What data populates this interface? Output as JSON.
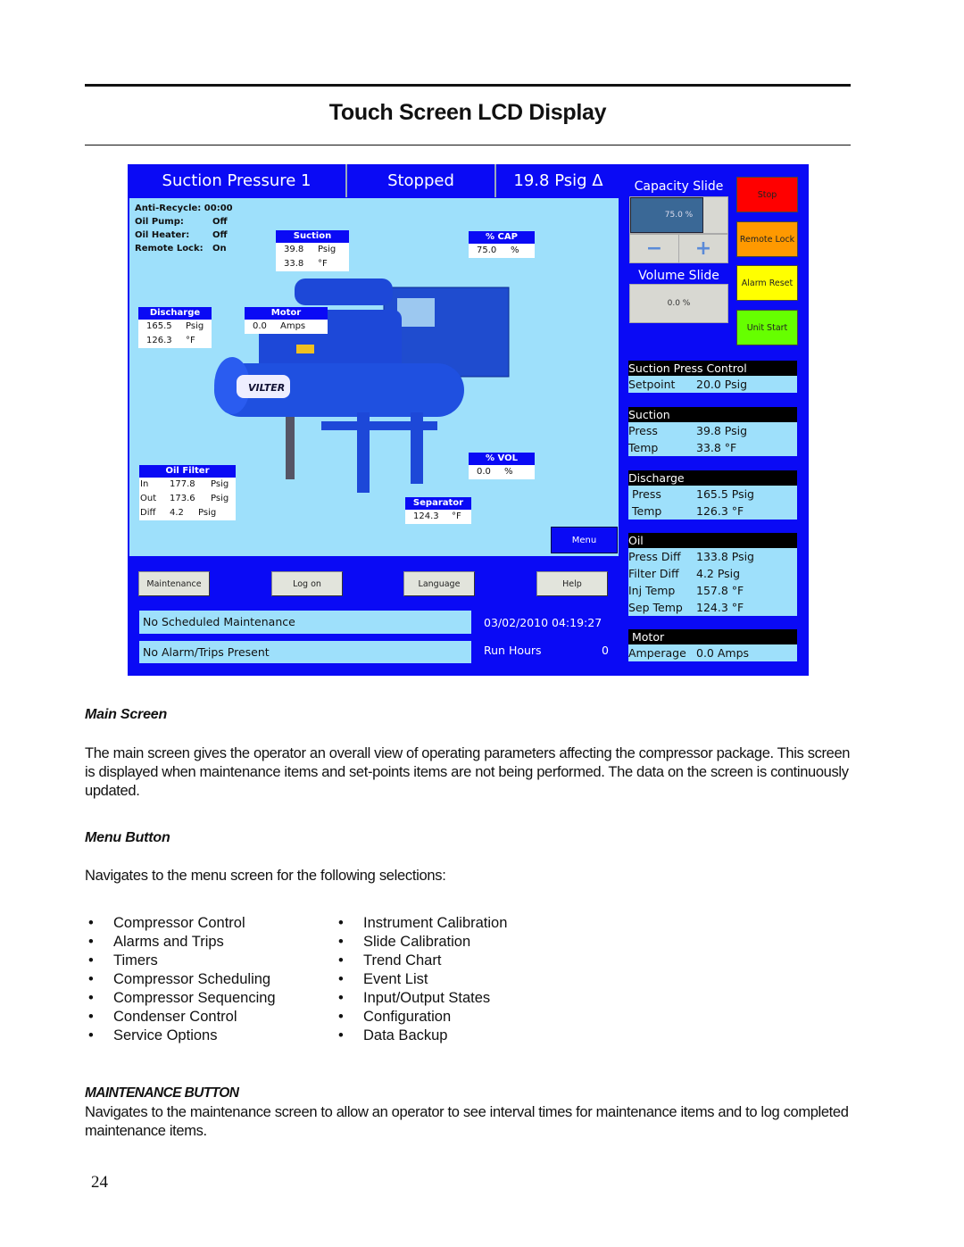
{
  "page": {
    "title": "Touch Screen LCD Display",
    "page_number": "24"
  },
  "screen": {
    "header": {
      "name": "Suction Pressure 1",
      "state": "Stopped",
      "pressure": "19.8 Psig Δ"
    },
    "status": [
      {
        "label": "Anti-Recycle:",
        "value": "00:00"
      },
      {
        "label": "Oil Pump:",
        "value": "Off"
      },
      {
        "label": "Oil Heater:",
        "value": "Off"
      },
      {
        "label": "Remote Lock:",
        "value": "On"
      }
    ],
    "suction": {
      "title": "Suction",
      "press": "39.8",
      "press_unit": "Psig",
      "temp": "33.8",
      "temp_unit": "°F"
    },
    "cap": {
      "title": "% CAP",
      "value": "75.0",
      "unit": "%"
    },
    "discharge": {
      "title": "Discharge",
      "press": "165.5",
      "press_unit": "Psig",
      "temp": "126.3",
      "temp_unit": "°F"
    },
    "motor": {
      "title": "Motor",
      "value": "0.0",
      "unit": "Amps"
    },
    "oil_filter": {
      "title": "Oil Filter",
      "rows": [
        {
          "label": "In",
          "value": "177.8",
          "unit": "Psig"
        },
        {
          "label": "Out",
          "value": "173.6",
          "unit": "Psig"
        },
        {
          "label": "Diff",
          "value": "4.2",
          "unit": "Psig"
        }
      ]
    },
    "vol": {
      "title": "% VOL",
      "value": "0.0",
      "unit": "%"
    },
    "separator": {
      "title": "Separator",
      "value": "124.3",
      "unit": "°F"
    },
    "logo": "VILTER",
    "menu_label": "Menu",
    "buttons": {
      "maintenance": "Maintenance",
      "logon": "Log on",
      "language": "Language",
      "help": "Help"
    },
    "maintenance_status": "No Scheduled Maintenance",
    "alarm_status": "No Alarm/Trips Present",
    "datetime": "03/02/2010  04:19:27",
    "run_hours_label": "Run Hours",
    "run_hours": "0",
    "capacity_slide": {
      "label": "Capacity Slide",
      "value_text": "75.0 %",
      "percent": 75,
      "minus": "minus-icon",
      "plus": "plus-icon"
    },
    "volume_slide": {
      "label": "Volume Slide",
      "value_text": "0.0 %",
      "percent": 0
    },
    "control_buttons": [
      {
        "label": "Stop",
        "color": "#ff0000"
      },
      {
        "label": "Remote Lock",
        "color": "#ff9900"
      },
      {
        "label": "Alarm Reset",
        "color": "#ffff00"
      },
      {
        "label": "Unit Start",
        "color": "#66ff00"
      }
    ],
    "panels": {
      "spc": {
        "title": "Suction Press Control",
        "rows": [
          {
            "label": "Setpoint",
            "value": "20.0 Psig"
          }
        ]
      },
      "suction": {
        "title": "Suction",
        "rows": [
          {
            "label": "Press",
            "value": "39.8 Psig"
          },
          {
            "label": "Temp",
            "value": "33.8 °F"
          }
        ]
      },
      "discharge": {
        "title": "Discharge",
        "rows": [
          {
            "label": "Press",
            "value": "165.5 Psig"
          },
          {
            "label": "Temp",
            "value": "126.3 °F"
          }
        ]
      },
      "oil": {
        "title": "Oil",
        "rows": [
          {
            "label": "Press Diff",
            "value": "133.8 Psig"
          },
          {
            "label": "Filter Diff",
            "value": "4.2 Psig"
          },
          {
            "label": "Inj Temp",
            "value": "157.8 °F"
          },
          {
            "label": "Sep Temp",
            "value": "124.3 °F"
          }
        ]
      },
      "motor": {
        "title": "Motor",
        "rows": [
          {
            "label": "Amperage",
            "value": "0.0 Amps"
          }
        ]
      }
    }
  },
  "sections": {
    "main_heading": "Main Screen",
    "main_text": "The main screen gives the operator an overall view of operating parameters affecting the compressor package. This screen is displayed when maintenance items and set-points items are not being performed.  The data on the screen is continuously updated.",
    "menu_heading": "Menu Button",
    "menu_text": "Navigates to the menu screen for the following selections:",
    "menu_col1": [
      "Compressor Control",
      "Alarms and Trips",
      "Timers",
      "Compressor Scheduling",
      "Compressor Sequencing",
      "Condenser Control",
      "Service Options"
    ],
    "menu_col2": [
      "Instrument Calibration",
      "Slide Calibration",
      "Trend Chart",
      "Event List",
      "Input/Output States",
      "Configuration",
      "Data Backup"
    ],
    "maint_heading": "MAINTENANCE BUTTON",
    "maint_text": "Navigates to the maintenance screen to allow an operator to see interval times for maintenance items and to log completed maintenance items."
  }
}
